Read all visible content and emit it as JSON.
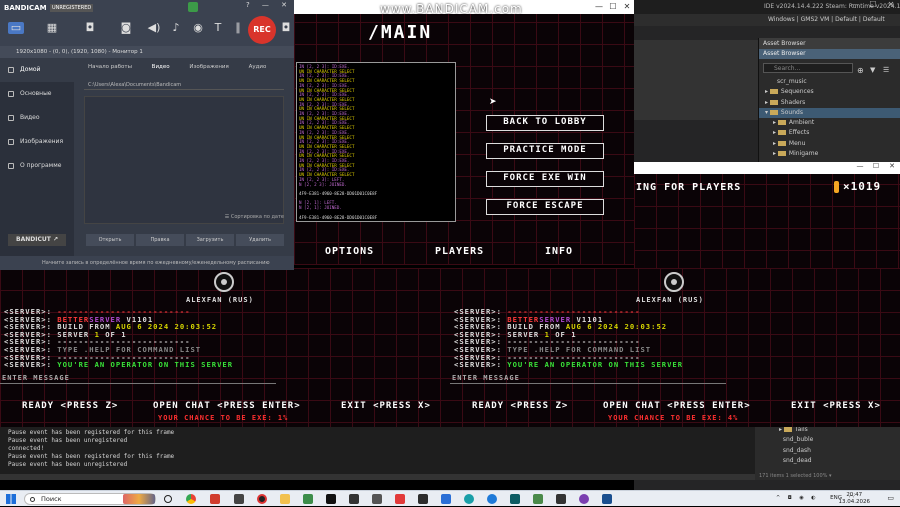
{
  "watermark": "www.BANDICAM.com",
  "ide": {
    "title": "IDE v2024.14.4.222 Steam: Runtime v2024.14.4.266",
    "menu": "Windows | GMS2 VM | Default | Default",
    "asset_browser": {
      "tab": "Asset Browser",
      "header": "Asset Browser",
      "search_placeholder": "Search...",
      "items": [
        "scr_music",
        "Sequences",
        "Shaders",
        "Sounds",
        "Ambient",
        "Effects",
        "Menu",
        "Minigame"
      ]
    },
    "lower_items": [
      "Tails",
      "snd_buble",
      "snd_dash",
      "snd_dead"
    ],
    "lower_footer": "171 items   1 selected   100% ▾"
  },
  "output": {
    "lines": [
      "Pause event has been registered for this frame",
      "Pause event has been unregistered",
      "connected!",
      "Pause event has been registered for this frame",
      "Pause event has been unregistered"
    ]
  },
  "bandicam": {
    "logo": "BANDICAM",
    "unregistered": "UNREGISTERED",
    "rec": "REC",
    "resolution": "1920x1080 - (0, 0), (1920, 1080) - Монитор 1",
    "nav": [
      "Домой",
      "Основные",
      "Видео",
      "Изображения",
      "О программе"
    ],
    "tabs": [
      "Начало работы",
      "Видео",
      "Изображения",
      "Аудио"
    ],
    "path": "C:\\Users\\Alexa\\Documents\\Bandicam",
    "sort": "☰ Сортировка по дате",
    "buttons": [
      "Открыть",
      "Правка",
      "Загрузить",
      "Удалить"
    ],
    "bandicut": "BANDICUT ↗",
    "footer": "Начните запись в определённое время по ежедневному/еженедельному расписанию"
  },
  "game": {
    "title": "/MAIN",
    "buttons": [
      "BACK TO LOBBY",
      "PRACTICE MODE",
      "FORCE EXE WIN",
      "FORCE ESCAPE"
    ],
    "nav": [
      "OPTIONS",
      "PLAYERS",
      "INFO"
    ],
    "console": [
      {
        "t": "IN [2, 2 3]: ID:EXE.",
        "c": "p"
      },
      {
        "t": "UN IN CHARACTER SELECT",
        "c": "y"
      },
      {
        "t": "IN [2, 2 3]: ID:EXE.",
        "c": "p"
      },
      {
        "t": "UN IN CHARACTER SELECT",
        "c": "y"
      },
      {
        "t": "IN [2, 2 3]: ID:EXE.",
        "c": "p"
      },
      {
        "t": "UN IN CHARACTER SELECT",
        "c": "y"
      },
      {
        "t": "IN [2, 2 3]: ID:EXE.",
        "c": "p"
      },
      {
        "t": "UN IN CHARACTER SELECT",
        "c": "y"
      },
      {
        "t": "IN [2, 2 3]: ID:EXE.",
        "c": "p"
      },
      {
        "t": "UN IN CHARACTER SELECT",
        "c": "y"
      },
      {
        "t": "IN [2, 2 3]: ID:EXE.",
        "c": "p"
      },
      {
        "t": "UN IN CHARACTER SELECT",
        "c": "y"
      },
      {
        "t": "IN [2, 2 3]: ID:EXE.",
        "c": "p"
      },
      {
        "t": "UN IN CHARACTER SELECT",
        "c": "y"
      },
      {
        "t": "IN [2, 2 3]: ID:EXE.",
        "c": "p"
      },
      {
        "t": "UN IN CHARACTER SELECT",
        "c": "y"
      },
      {
        "t": "IN [2, 2 3]: ID:EXE.",
        "c": "p"
      },
      {
        "t": "UN IN CHARACTER SELECT",
        "c": "y"
      },
      {
        "t": "IN [2, 2 3]: ID:EXE.",
        "c": "p"
      },
      {
        "t": "UN IN CHARACTER SELECT",
        "c": "y"
      },
      {
        "t": "IN [2, 2 3]: ID:EXE.",
        "c": "p"
      },
      {
        "t": "UN IN CHARACTER SELECT",
        "c": "y"
      },
      {
        "t": "IN [2, 2 3]: ID:EXE.",
        "c": "p"
      },
      {
        "t": "UN IN CHARACTER SELECT",
        "c": "y"
      },
      {
        "t": "IN [2, 2 3]: LEFT.",
        "c": "p"
      },
      {
        "t": "N [2, 2 3]: JOINED.",
        "c": "p"
      },
      {
        "t": "",
        "c": ""
      },
      {
        "t": "4F9-E381-4960-8E28-DD01D01C0E8F",
        "c": ""
      },
      {
        "t": "",
        "c": ""
      },
      {
        "t": "N [2, 1]: LEFT.",
        "c": "p"
      },
      {
        "t": "N [2, 1]: JOINED.",
        "c": "p"
      },
      {
        "t": "",
        "c": ""
      },
      {
        "t": "4F9-E381-4960-8E28-DD01D01C0E8F",
        "c": ""
      }
    ]
  },
  "waiting": {
    "text": "ING FOR PLAYERS",
    "coins": "×1019"
  },
  "lobby": {
    "player_name": "ALEXFAN (RUS)",
    "log": [
      {
        "pre": "<SERVER>:",
        "parts": [
          {
            "t": " ",
            "c": ""
          },
          {
            "t": "-------------------------",
            "c": "r"
          }
        ]
      },
      {
        "pre": "<SERVER>:",
        "parts": [
          {
            "t": " ",
            "c": ""
          },
          {
            "t": "BETTER",
            "c": "r"
          },
          {
            "t": "SERVER",
            "c": "p"
          },
          {
            "t": " V1101",
            "c": ""
          }
        ]
      },
      {
        "pre": "<SERVER>:",
        "parts": [
          {
            "t": " BUILD FROM ",
            "c": ""
          },
          {
            "t": "AUG  6 2024 20:03:52",
            "c": "y"
          }
        ]
      },
      {
        "pre": "<SERVER>:",
        "parts": [
          {
            "t": " SERVER ",
            "c": ""
          },
          {
            "t": "1",
            "c": "y"
          },
          {
            "t": " OF 1",
            "c": ""
          }
        ]
      },
      {
        "pre": "<SERVER>:",
        "parts": [
          {
            "t": " -------------------------",
            "c": ""
          }
        ]
      },
      {
        "pre": "<SERVER>:",
        "parts": [
          {
            "t": " TYPE .HELP FOR COMMAND LIST",
            "c": "gr"
          }
        ]
      },
      {
        "pre": "<SERVER>:",
        "parts": [
          {
            "t": " -------------------------",
            "c": ""
          }
        ]
      },
      {
        "pre": "<SERVER>:",
        "parts": [
          {
            "t": " YOU'RE AN OPERATOR ON THIS SERVER",
            "c": "g"
          }
        ]
      }
    ],
    "enter": "ENTER MESSAGE",
    "ready": "READY <PRESS Z>",
    "chat": "OPEN CHAT <PRESS ENTER>",
    "exit": "EXIT <PRESS X>",
    "chance_left": "YOUR CHANCE TO BE EXE: 1%",
    "chance_right": "YOUR CHANCE TO BE EXE: 4%"
  },
  "taskbar": {
    "search": "Поиск",
    "lang": "ENG",
    "time": "20:47",
    "date": "13.04.2026"
  }
}
